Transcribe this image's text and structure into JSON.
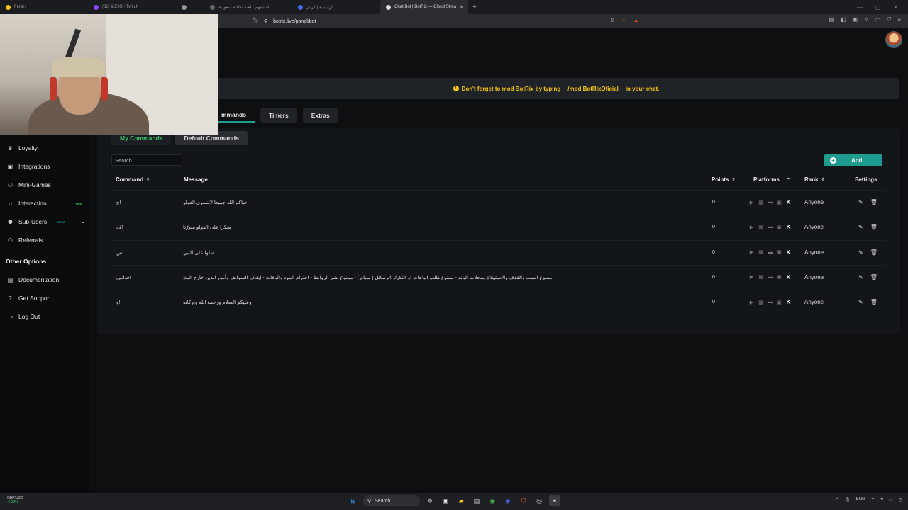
{
  "browser": {
    "tabs": [
      {
        "label": "Feral+",
        "fav": "#f5c518",
        "active": false
      },
      {
        "label": "(32) ILE9X - Twitch",
        "fav": "#9146ff",
        "active": false
      },
      {
        "label": "",
        "fav": "#999",
        "active": false
      },
      {
        "label": "استيقهم - لعبة ثقافية سعودية",
        "fav": "#666",
        "active": false
      },
      {
        "label": "الرئيسية | كرتيز",
        "fav": "#3a6df0",
        "active": false
      },
      {
        "label": "Chat Bot | BotRix — Cloud Strea",
        "fav": "#ddd",
        "active": true
      }
    ],
    "new_tab_symbol": "+",
    "url": "botrix.live/panel/bot",
    "bookmark_icon": "bookmark-icon"
  },
  "banner": {
    "text_before": "Don't forget to mod BotRix by typing",
    "command": "/mod BotRixOficial",
    "text_after": "in your chat."
  },
  "main_tabs": [
    "mmands",
    "Timers",
    "Extras"
  ],
  "sub_tabs": [
    "My Commands",
    "Default Commands"
  ],
  "search": {
    "placeholder": "Search..."
  },
  "add_button": {
    "label": "Add"
  },
  "table": {
    "headers": {
      "command": "Command",
      "message": "Message",
      "points": "Points",
      "platforms": "Platforms",
      "rank": "Rank",
      "settings": "Settings"
    },
    "rows": [
      {
        "command": "!ج",
        "message": "حياكم الله جميعا لاتنسون الفولو",
        "points": "0",
        "rank": "Anyone"
      },
      {
        "command": "!ف",
        "message": "شكرا على الفولو منورّنا",
        "points": "0",
        "rank": "Anyone"
      },
      {
        "command": "!ص",
        "message": "صلوا على النبي",
        "points": "0",
        "rank": "Anyone"
      },
      {
        "command": "!قوانين",
        "message": "ممنوع السب والقذف والاستهلاك بمحلات الباند - ممنوع طلب الباجات او التكرار الرسائل ( سبام ) - ممنوع نشر الروابط - احترام المود والباقات - إيقاف السوالف وأمور الدين خارج البث",
        "points": "0",
        "rank": "Anyone"
      },
      {
        "command": "!و",
        "message": "وعليكم السلام ورحمة الله وبركاته",
        "points": "0",
        "rank": "Anyone"
      }
    ]
  },
  "sidebar": {
    "items": [
      {
        "label": "Loyalty",
        "icon": "trophy-icon",
        "badge": ""
      },
      {
        "label": "Integrations",
        "icon": "puzzle-icon",
        "badge": ""
      },
      {
        "label": "Mini-Games",
        "icon": "gamepad-icon",
        "badge": ""
      },
      {
        "label": "Interaction",
        "icon": "music-icon",
        "badge": "NEW"
      },
      {
        "label": "Sub-Users",
        "icon": "users-icon",
        "badge": "BETA"
      },
      {
        "label": "Referrals",
        "icon": "people-icon",
        "badge": ""
      }
    ],
    "other_heading": "Other Options",
    "other_items": [
      {
        "label": "Documentation",
        "icon": "book-icon"
      },
      {
        "label": "Get Support",
        "icon": "help-icon"
      },
      {
        "label": "Log Out",
        "icon": "logout-icon"
      }
    ]
  },
  "colors": {
    "accent": "#1f9c8f",
    "green": "#3cc36a",
    "warning": "#f5c518"
  },
  "taskbar": {
    "ticker": "GBP/USD",
    "ticker_change": "-0.20%",
    "search_label": "Search",
    "lang": "ENG"
  }
}
